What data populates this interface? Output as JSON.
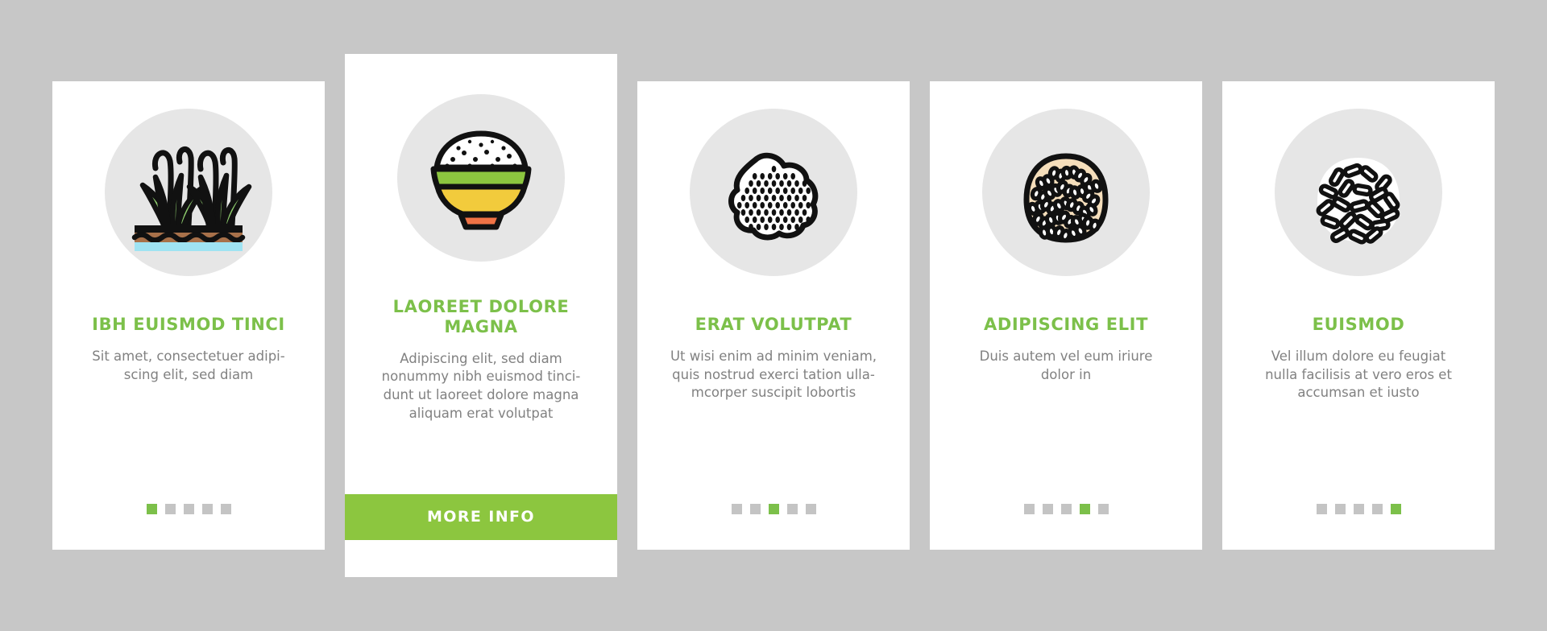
{
  "theme": {
    "background": "#c7c7c7",
    "card_background": "#ffffff",
    "accent_green": "#7cc04a",
    "button_green": "#8cc63f",
    "body_text": "#818181",
    "icon_circle": "#e6e6e6",
    "dot_inactive": "#c4c4c4"
  },
  "cards": [
    {
      "icon_name": "rice-plants-in-paddy-field-icon",
      "title": "IBH EUISMOD TINCI",
      "description": "Sit amet, consectetuer adipi-\nscing elit, sed diam",
      "dots": {
        "count": 5,
        "active_index": 1
      },
      "featured": false,
      "cta_label": null
    },
    {
      "icon_name": "rice-bowl-icon",
      "title": "LAOREET DOLORE MAGNA",
      "description": "Adipiscing elit, sed diam\nnonummy nibh euismod tinci-\ndunt ut laoreet dolore magna\naliquam erat volutpat",
      "dots": null,
      "featured": true,
      "cta_label": "MORE INFO"
    },
    {
      "icon_name": "cooked-rice-clump-icon",
      "title": "ERAT VOLUTPAT",
      "description": "Ut wisi enim ad minim veniam,\nquis nostrud exerci tation ulla-\nmcorper suscipit lobortis",
      "dots": {
        "count": 5,
        "active_index": 3
      },
      "featured": false,
      "cta_label": null
    },
    {
      "icon_name": "brown-rice-grain-heap-icon",
      "title": "ADIPISCING ELIT",
      "description": "Duis autem vel eum iriure\ndolor in",
      "dots": {
        "count": 5,
        "active_index": 4
      },
      "featured": false,
      "cta_label": null
    },
    {
      "icon_name": "long-rice-grains-pile-icon",
      "title": "EUISMOD",
      "description": "Vel illum dolore eu feugiat\nnulla facilisis at vero eros et\naccumsan et iusto",
      "dots": {
        "count": 5,
        "active_index": 5
      },
      "featured": false,
      "cta_label": null
    }
  ]
}
